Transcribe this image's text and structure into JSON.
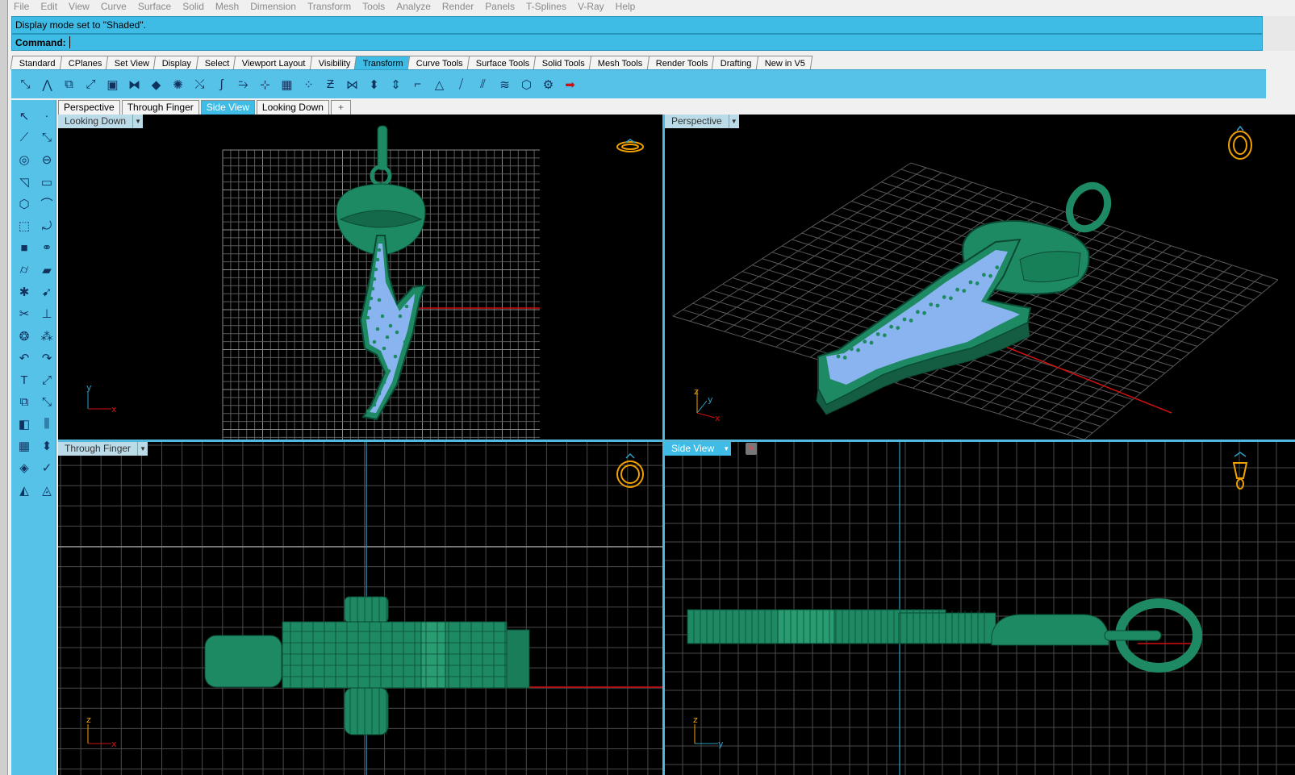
{
  "menu": [
    "File",
    "Edit",
    "View",
    "Curve",
    "Surface",
    "Solid",
    "Mesh",
    "Dimension",
    "Transform",
    "Tools",
    "Analyze",
    "Render",
    "Panels",
    "T-Splines",
    "V-Ray",
    "Help"
  ],
  "command_history": "Display mode set to \"Shaded\".",
  "command_prompt": "Command:",
  "command_value": "",
  "toolbar_tabs": [
    {
      "label": "Standard",
      "active": false
    },
    {
      "label": "CPlanes",
      "active": false
    },
    {
      "label": "Set View",
      "active": false
    },
    {
      "label": "Display",
      "active": false
    },
    {
      "label": "Select",
      "active": false
    },
    {
      "label": "Viewport Layout",
      "active": false
    },
    {
      "label": "Visibility",
      "active": false
    },
    {
      "label": "Transform",
      "active": true
    },
    {
      "label": "Curve Tools",
      "active": false
    },
    {
      "label": "Surface Tools",
      "active": false
    },
    {
      "label": "Solid Tools",
      "active": false
    },
    {
      "label": "Mesh Tools",
      "active": false
    },
    {
      "label": "Render Tools",
      "active": false
    },
    {
      "label": "Drafting",
      "active": false
    },
    {
      "label": "New in V5",
      "active": false
    }
  ],
  "viewport_tabs": [
    {
      "label": "Perspective",
      "active": false
    },
    {
      "label": "Through Finger",
      "active": false
    },
    {
      "label": "Side View",
      "active": true
    },
    {
      "label": "Looking Down",
      "active": false
    },
    {
      "label": "+",
      "active": false
    }
  ],
  "viewports": {
    "top_left": {
      "title": "Looking Down",
      "axis_a": "y",
      "axis_b": "x"
    },
    "top_right": {
      "title": "Perspective",
      "axis_a": "z",
      "axis_b": "y",
      "axis_c": "x"
    },
    "bottom_left": {
      "title": "Through Finger",
      "axis_a": "z",
      "axis_b": "x"
    },
    "bottom_right": {
      "title": "Side View",
      "axis_a": "z",
      "axis_b": "y"
    }
  },
  "colors": {
    "accent": "#3fbce6",
    "panel": "#56c2e8",
    "model": "#1e8a63",
    "gems": "#8ab4f0",
    "grid": "#5a5a5a",
    "axis_x": "#d01010",
    "axis_y": "#2ea0c8",
    "gizmo": "#f0a000"
  }
}
